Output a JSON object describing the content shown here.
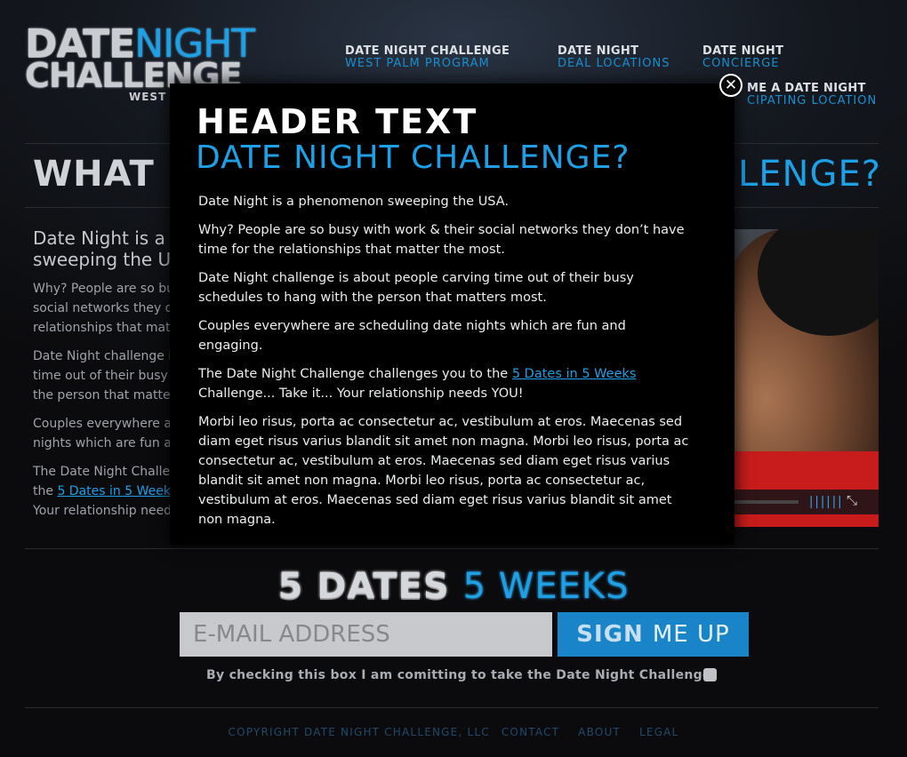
{
  "logo": {
    "date": "DATE",
    "night": "NIGHT",
    "challenge": "CHALLENGE",
    "sub": "WEST"
  },
  "nav": [
    {
      "line1": "DATE NIGHT CHALLENGE",
      "line2": "WEST PALM PROGRAM"
    },
    {
      "line1": "DATE NIGHT",
      "line2": "DEAL LOCATIONS"
    },
    {
      "line1": "DATE NIGHT",
      "line2": "CONCIERGE"
    },
    {
      "line1": "ME A DATE NIGHT",
      "line2": "CIPATING LOCATION"
    }
  ],
  "background": {
    "heading_left": "WHAT",
    "heading_right": "LENGE?",
    "lead": "Date Night is a p\nsweeping the US",
    "paragraphs": [
      "Why? People are so bu\nsocial networks they d\nrelationships that matt",
      "Date Night challenge is\ntime out of their busy s\nthe person that matters",
      "Couples everywhere ar\nnights which are fun ar"
    ],
    "last_para_line1": "The Date Night Challer",
    "last_para_the": "the ",
    "last_para_link": "5 Dates in 5 Weeks",
    "last_para_line3": "Your relationship need"
  },
  "modal": {
    "header": "HEADER TEXT",
    "subheader": "DATE NIGHT CHALLENGE?",
    "p1": "Date Night is a phenomenon sweeping the USA.",
    "p2": "Why? People are so busy with work & their social networks they don’t have time for the relationships that matter the most.",
    "p3": "Date Night challenge is about people carving time out of their busy schedules to hang with the person that matters most.",
    "p4": "Couples everywhere are scheduling date nights which are fun and engaging.",
    "p5_before": "The Date Night Challenge challenges you to the ",
    "p5_link": "5 Dates in 5 Weeks",
    "p5_after": " Challenge... Take it... Your relationship needs YOU!",
    "p6": "Morbi leo risus, porta ac consectetur ac, vestibulum at eros. Maecenas sed diam eget risus varius blandit sit amet non magna. Morbi leo risus, porta ac consectetur ac, vestibulum at eros. Maecenas sed diam eget risus varius blandit sit amet non magna. Morbi leo risus, porta ac consectetur ac, vestibulum at eros. Maecenas sed diam eget risus varius blandit sit amet non magna.",
    "close_glyph": "✕"
  },
  "signup": {
    "title_bold": "5 DATES",
    "title_light": "5 WEEKS",
    "email_placeholder": "E-MAIL ADDRESS",
    "button_bold": "SIGN",
    "button_light": "ME UP",
    "commit_text": "By checking this box I am comitting to take the Date Night Challenge"
  },
  "footer": {
    "copyright": "COPYRIGHT DATE NIGHT CHALLENGE, LLC",
    "contact": "CONTACT",
    "about": "ABOUT",
    "legal": "LEGAL"
  },
  "colors": {
    "accent": "#1ea0e6",
    "button": "#1a84c8",
    "modal_bg": "#000000"
  }
}
